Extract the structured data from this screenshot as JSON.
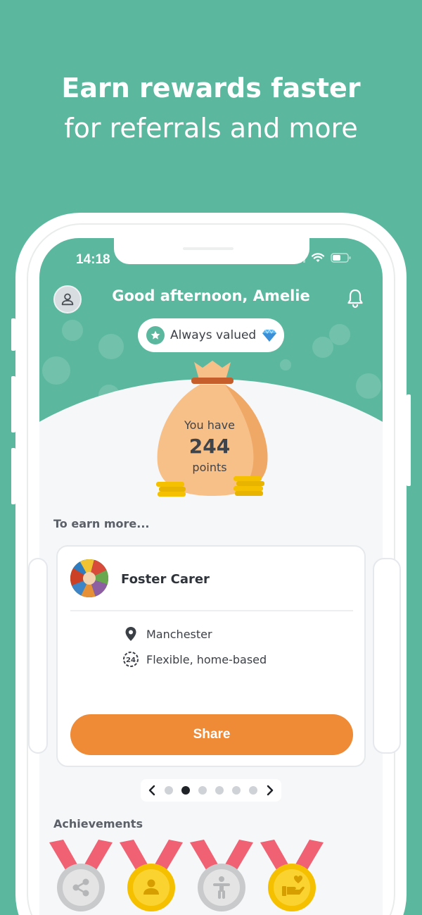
{
  "headline": {
    "line1": "Earn rewards faster",
    "line2": "for referrals and more"
  },
  "status_bar": {
    "time": "14:18"
  },
  "header": {
    "greeting": "Good afternoon, Amelie",
    "badge_text": "Always valued"
  },
  "points": {
    "prefix": "You have",
    "value": "244",
    "suffix": "points"
  },
  "earn_section": {
    "title": "To earn more...",
    "card": {
      "title": "Foster Carer",
      "location": "Manchester",
      "schedule": "Flexible, home-based",
      "button": "Share"
    },
    "pager": {
      "total": 6,
      "active_index": 1
    }
  },
  "achievements": {
    "title": "Achievements",
    "medals": [
      {
        "icon": "share-icon",
        "tier": "silver"
      },
      {
        "icon": "person-icon",
        "tier": "gold"
      },
      {
        "icon": "accessibility-icon",
        "tier": "silver"
      },
      {
        "icon": "helping-hand-icon",
        "tier": "gold"
      }
    ]
  },
  "colors": {
    "brand": "#5bb89e",
    "accent": "#ef8a37",
    "gold": "#f5c000",
    "silver": "#c9cacb",
    "ribbon": "#ef6173"
  }
}
